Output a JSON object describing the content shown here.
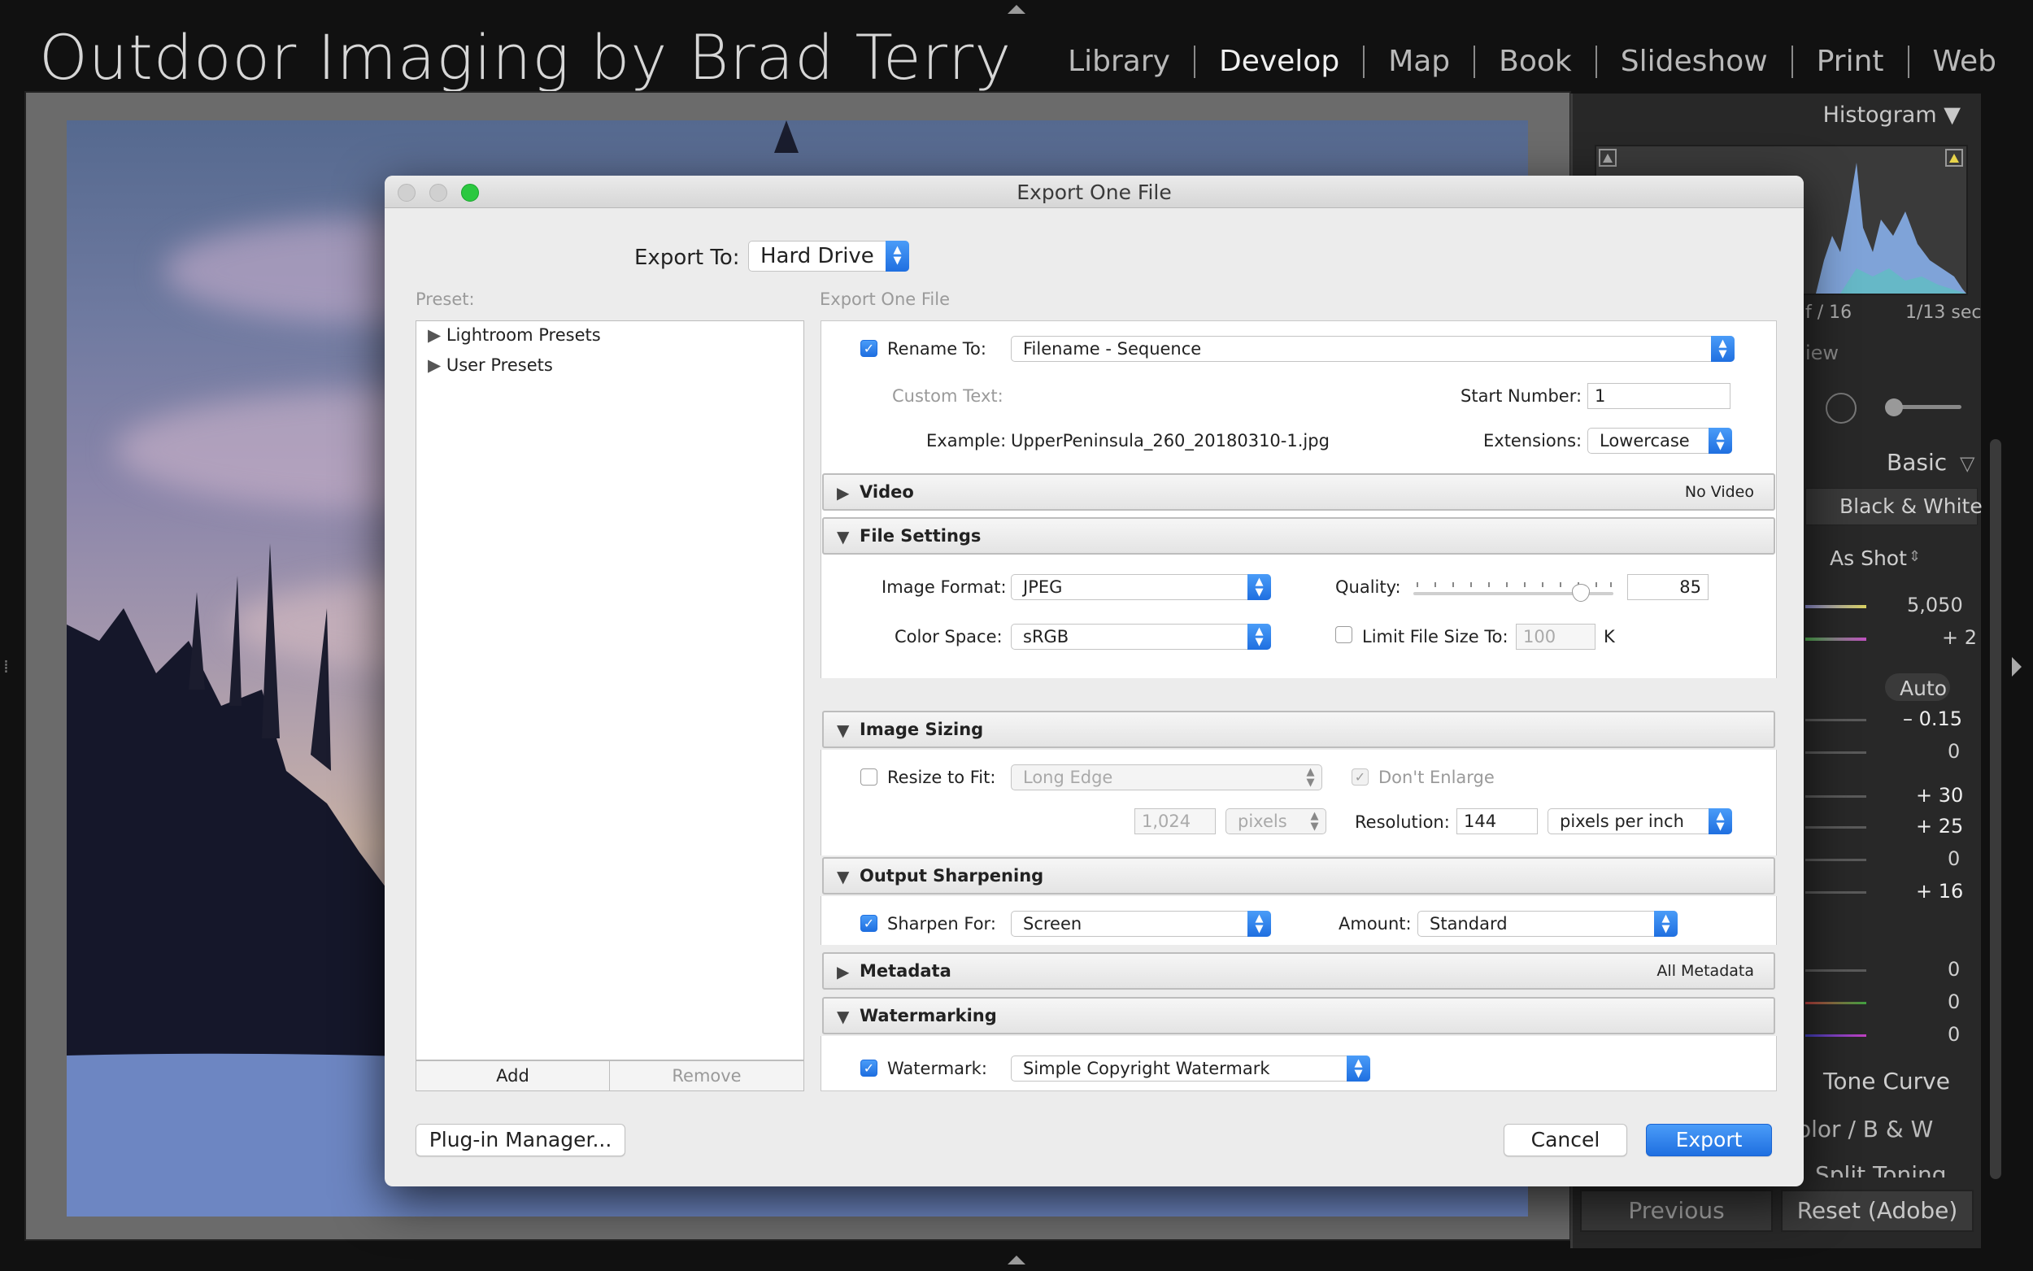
{
  "app": {
    "identity_plate": "Outdoor Imaging by Brad Terry",
    "modules": [
      "Library",
      "Develop",
      "Map",
      "Book",
      "Slideshow",
      "Print",
      "Web"
    ],
    "active_module": "Develop"
  },
  "right_panel": {
    "histogram_title": "Histogram",
    "aperture": "f / 16",
    "shutter": "1/13 sec",
    "preview_partial": "iew",
    "basic_title": "Basic",
    "treatment_bw": "Black & White",
    "wb_value": "As Shot",
    "temp_value": "5,050",
    "tint_value": "+ 2",
    "auto_label": "Auto",
    "exposure_value": "– 0.15",
    "contrast_value": "0",
    "highlights_value": "+ 30",
    "shadows_value": "+ 25",
    "whites_value": "0",
    "blacks_value": "+ 16",
    "presence_values": [
      "0",
      "0",
      "0"
    ],
    "tone_curve": "Tone Curve",
    "color_bw": "olor  /  B & W",
    "split_toning": "Split Toning",
    "previous": "Previous",
    "reset": "Reset (Adobe)"
  },
  "dialog": {
    "title": "Export One File",
    "export_to_label": "Export To:",
    "export_to_value": "Hard Drive",
    "preset_label": "Preset:",
    "presets": [
      "Lightroom Presets",
      "User Presets"
    ],
    "add": "Add",
    "remove": "Remove",
    "settings_header": "Export One File",
    "rename_label": "Rename To:",
    "rename_value": "Filename - Sequence",
    "custom_text_label": "Custom Text:",
    "start_number_label": "Start Number:",
    "start_number_value": "1",
    "example_label": "Example:",
    "example_value": "UpperPeninsula_260_20180310-1.jpg",
    "extensions_label": "Extensions:",
    "extensions_value": "Lowercase",
    "sections": {
      "video": {
        "title": "Video",
        "summary": "No Video"
      },
      "file_settings": {
        "title": "File Settings"
      },
      "image_sizing": {
        "title": "Image Sizing"
      },
      "output_sharpening": {
        "title": "Output Sharpening"
      },
      "metadata": {
        "title": "Metadata",
        "summary": "All Metadata"
      },
      "watermarking": {
        "title": "Watermarking"
      }
    },
    "image_format_label": "Image Format:",
    "image_format_value": "JPEG",
    "quality_label": "Quality:",
    "quality_value": "85",
    "color_space_label": "Color Space:",
    "color_space_value": "sRGB",
    "limit_size_label": "Limit File Size To:",
    "limit_size_value": "100",
    "limit_size_unit": "K",
    "resize_label": "Resize to Fit:",
    "resize_value": "Long Edge",
    "dont_enlarge_label": "Don't Enlarge",
    "size_value": "1,024",
    "size_unit": "pixels",
    "resolution_label": "Resolution:",
    "resolution_value": "144",
    "resolution_unit": "pixels per inch",
    "sharpen_label": "Sharpen For:",
    "sharpen_value": "Screen",
    "amount_label": "Amount:",
    "amount_value": "Standard",
    "watermark_label": "Watermark:",
    "watermark_value": "Simple Copyright Watermark",
    "plugin_manager": "Plug-in Manager...",
    "cancel": "Cancel",
    "export": "Export"
  },
  "colors": {
    "accent": "#2a82ee",
    "close": "#cfcfcf",
    "zoom": "#2bc840"
  }
}
